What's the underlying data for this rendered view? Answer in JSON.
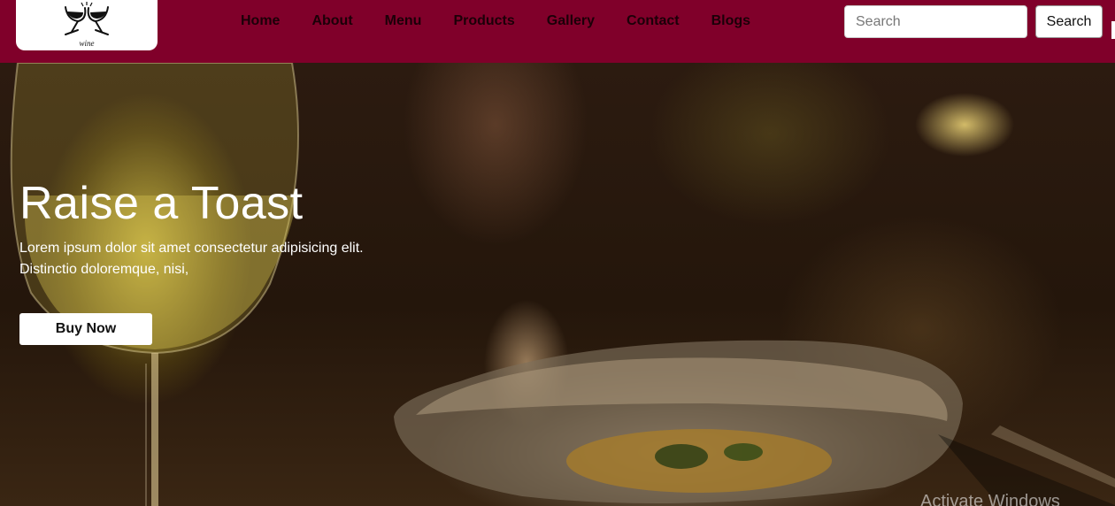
{
  "navbar": {
    "logo_text": "wine",
    "links": [
      "Home",
      "About",
      "Menu",
      "Products",
      "Gallery",
      "Contact",
      "Blogs"
    ],
    "search": {
      "placeholder": "Search",
      "button_label": "Search"
    }
  },
  "hero": {
    "title": "Raise a Toast",
    "description_lines": [
      "Lorem ipsum dolor sit amet consectetur adipisicing elit.",
      "Distinctio doloremque, nisi,"
    ],
    "button_label": "Buy Now"
  },
  "overlay": {
    "watermark_text": "Activate Windows"
  },
  "colors": {
    "navbar": "#80002a",
    "nav_link": "#1b0008",
    "hero_text": "#ffffff"
  },
  "icons": {
    "logo": "wine-glasses-icon"
  }
}
